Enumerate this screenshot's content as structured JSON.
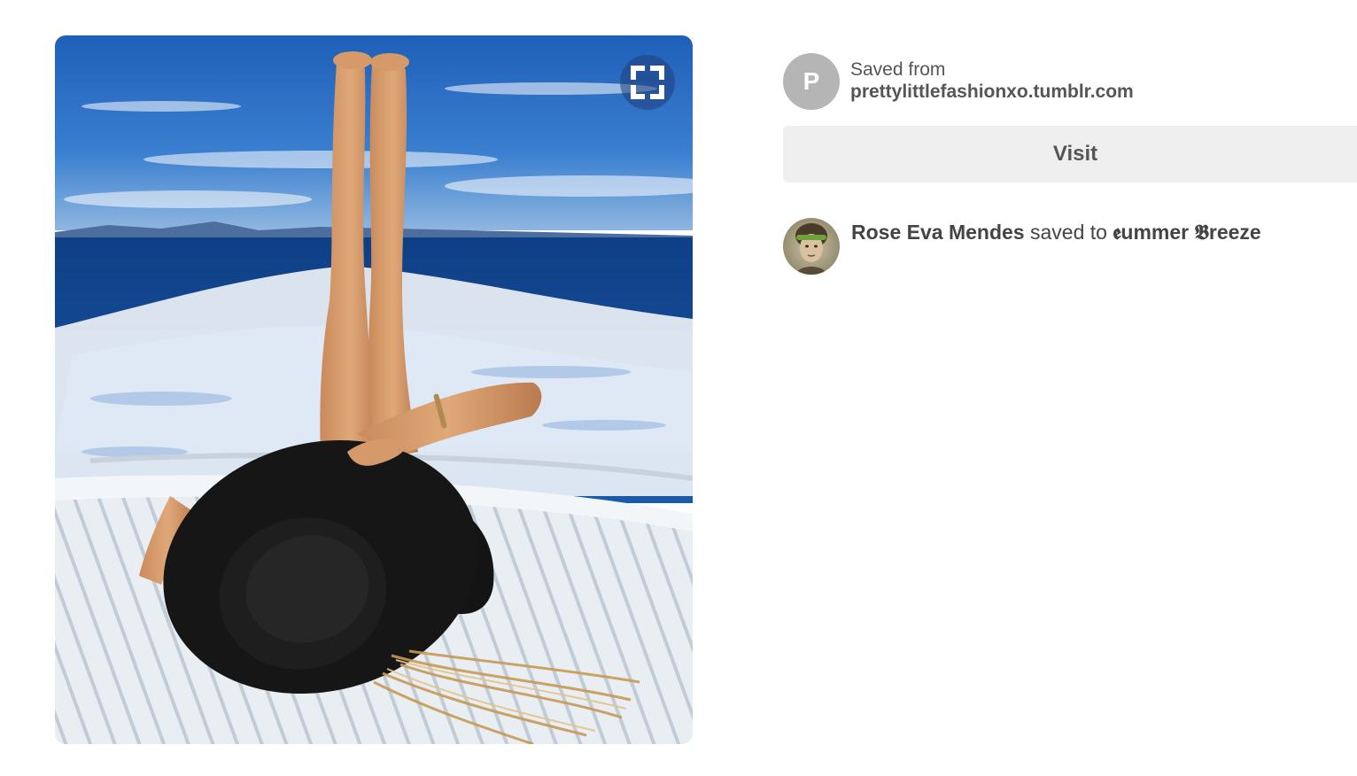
{
  "pin": {
    "image_alt": "Woman lying on a boat deck with legs raised, wearing a wide black sun hat, ocean wake behind",
    "expand_icon": "expand-icon"
  },
  "source": {
    "avatar_letter": "P",
    "saved_from_label": "Saved from",
    "domain": "prettylittlefashionxo.tumblr.com"
  },
  "visit": {
    "label": "Visit"
  },
  "saver": {
    "name": "Rose Eva Mendes",
    "action_text": " saved to ",
    "board": "𝖊ummer 𝕭reeze"
  },
  "colors": {
    "button_bg": "#efefef",
    "text": "#555555",
    "avatar_bg": "#b5b5b5"
  }
}
